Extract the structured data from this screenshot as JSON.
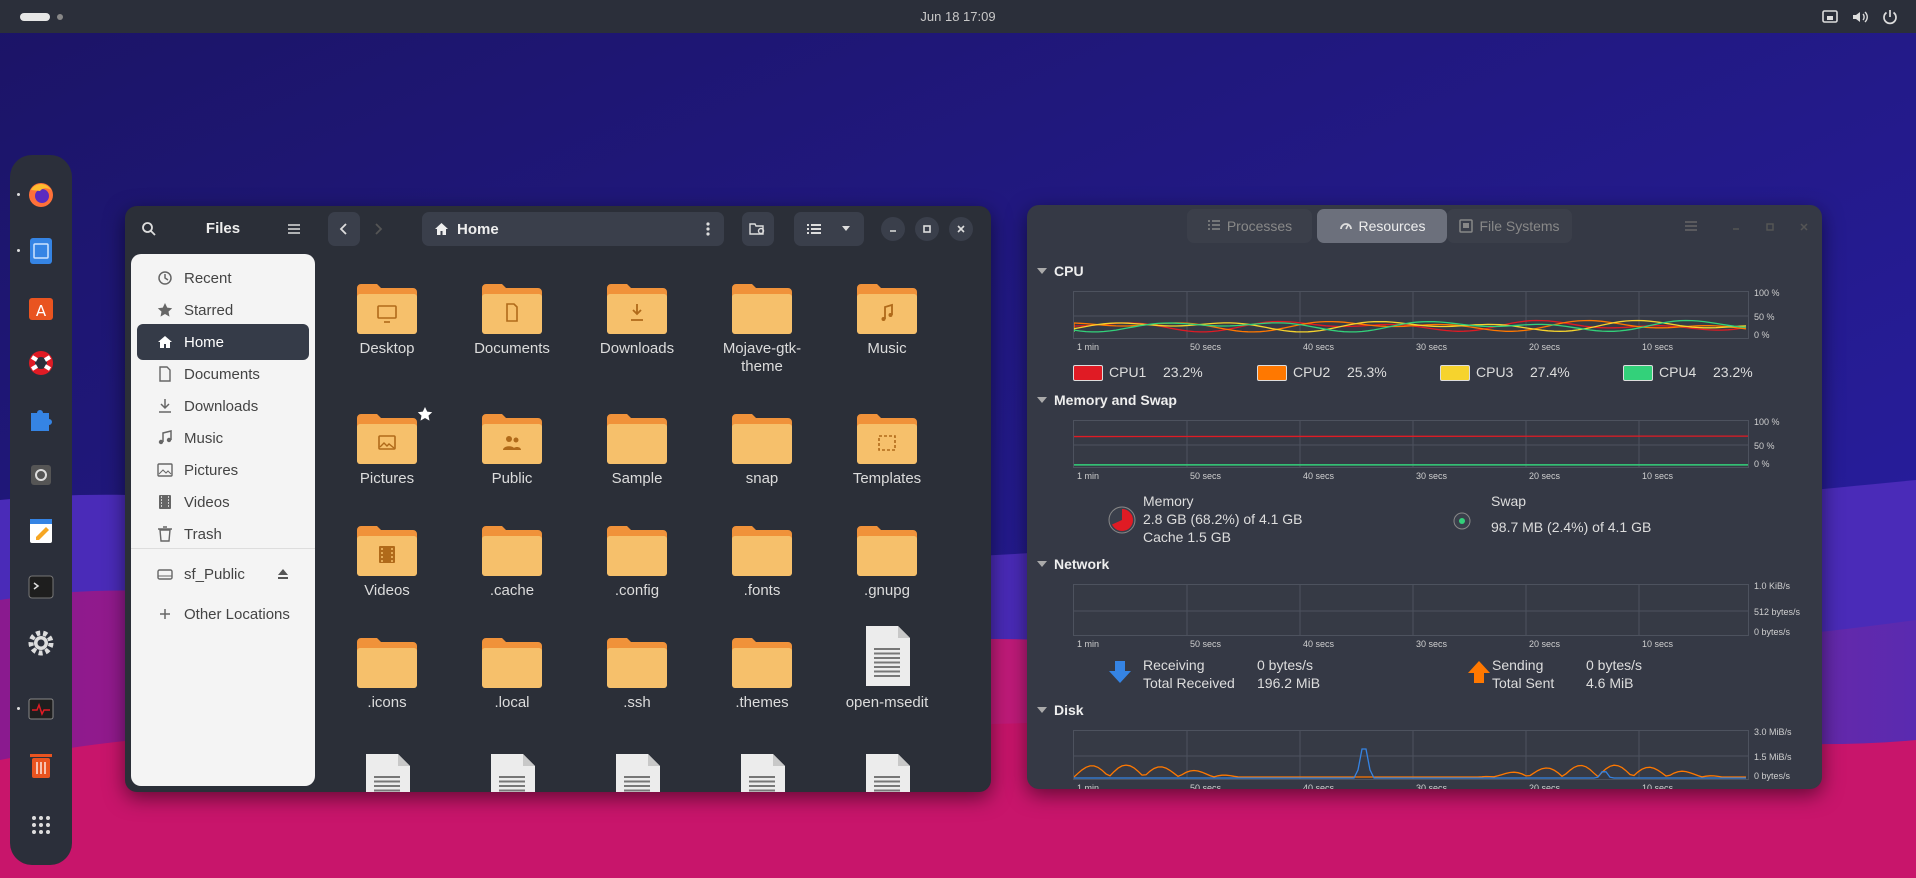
{
  "topbar": {
    "datetime": "Jun 18  17:09"
  },
  "files": {
    "title": "Files",
    "location": "Home",
    "sidebar": [
      {
        "label": "Recent",
        "icon": "clock-icon"
      },
      {
        "label": "Starred",
        "icon": "star-icon"
      },
      {
        "label": "Home",
        "icon": "home-icon",
        "active": true
      },
      {
        "label": "Documents",
        "icon": "document-icon"
      },
      {
        "label": "Downloads",
        "icon": "download-icon"
      },
      {
        "label": "Music",
        "icon": "music-icon"
      },
      {
        "label": "Pictures",
        "icon": "picture-icon"
      },
      {
        "label": "Videos",
        "icon": "video-icon"
      },
      {
        "label": "Trash",
        "icon": "trash-icon"
      },
      {
        "label": "sf_Public",
        "icon": "drive-icon"
      },
      {
        "label": "Other Locations",
        "icon": "plus-icon"
      }
    ],
    "items": [
      {
        "label": "Desktop",
        "emblem": "desktop"
      },
      {
        "label": "Documents",
        "emblem": "doc"
      },
      {
        "label": "Downloads",
        "emblem": "down"
      },
      {
        "label": "Mojave-gtk-theme",
        "emblem": ""
      },
      {
        "label": "Music",
        "emblem": "music"
      },
      {
        "label": "Pictures",
        "emblem": "pic",
        "starred": true
      },
      {
        "label": "Public",
        "emblem": "people"
      },
      {
        "label": "Sample",
        "emblem": ""
      },
      {
        "label": "snap",
        "emblem": ""
      },
      {
        "label": "Templates",
        "emblem": "tmpl"
      },
      {
        "label": "Videos",
        "emblem": "film"
      },
      {
        "label": ".cache",
        "emblem": ""
      },
      {
        "label": ".config",
        "emblem": ""
      },
      {
        "label": ".fonts",
        "emblem": ""
      },
      {
        "label": ".gnupg",
        "emblem": ""
      },
      {
        "label": ".icons",
        "emblem": ""
      },
      {
        "label": ".local",
        "emblem": ""
      },
      {
        "label": ".ssh",
        "emblem": ""
      },
      {
        "label": ".themes",
        "emblem": ""
      },
      {
        "label": "open-msedit",
        "emblem": "textfile"
      }
    ]
  },
  "sysmon": {
    "tabs": [
      {
        "label": "Processes",
        "icon": "list-icon"
      },
      {
        "label": "Resources",
        "icon": "gauge-icon",
        "active": true
      },
      {
        "label": "File Systems",
        "icon": "disk-icon"
      }
    ],
    "cpu": {
      "title": "CPU",
      "cores": [
        {
          "name": "CPU1",
          "value": "23.2%",
          "color": "#e01b24"
        },
        {
          "name": "CPU2",
          "value": "25.3%",
          "color": "#ff7800"
        },
        {
          "name": "CPU3",
          "value": "27.4%",
          "color": "#f6d32d"
        },
        {
          "name": "CPU4",
          "value": "23.2%",
          "color": "#33d17a"
        }
      ],
      "yticks": [
        "100 %",
        "50 %",
        "0 %"
      ]
    },
    "memory": {
      "title": "Memory and Swap",
      "yticks": [
        "100 %",
        "50 %",
        "0 %"
      ],
      "mem_label": "Memory",
      "mem_value": "2.8 GB (68.2%) of 4.1 GB",
      "cache": "Cache 1.5 GB",
      "swap_label": "Swap",
      "swap_value": "98.7 MB (2.4%) of 4.1 GB",
      "mem_fraction": 0.682,
      "swap_fraction": 0.024
    },
    "network": {
      "title": "Network",
      "yticks": [
        "1.0 KiB/s",
        "512 bytes/s",
        "0 bytes/s"
      ],
      "recv_label": "Receiving",
      "recv_value": "0 bytes/s",
      "total_recv_label": "Total Received",
      "total_recv_value": "196.2 MiB",
      "send_label": "Sending",
      "send_value": "0 bytes/s",
      "total_sent_label": "Total Sent",
      "total_sent_value": "4.6 MiB"
    },
    "disk": {
      "title": "Disk",
      "yticks": [
        "3.0 MiB/s",
        "1.5 MiB/s",
        "0 bytes/s"
      ]
    },
    "xticks": [
      "1 min",
      "50 secs",
      "40 secs",
      "30 secs",
      "20 secs",
      "10 secs"
    ]
  }
}
